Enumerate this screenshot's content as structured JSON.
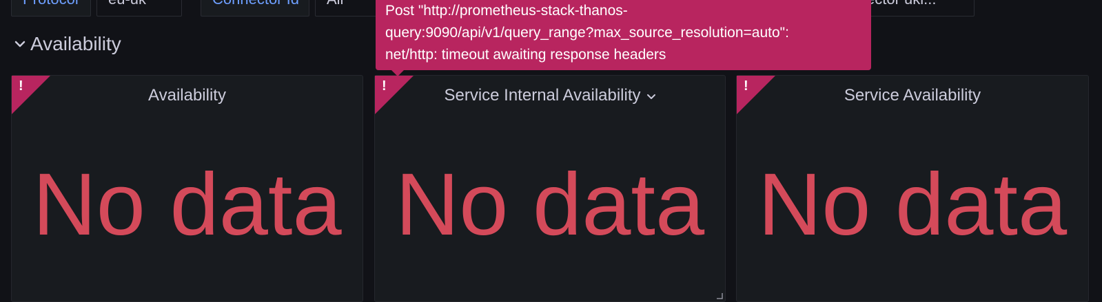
{
  "variables": [
    {
      "label": "Protocol",
      "value": "eu-uk"
    },
    {
      "label": "Connector Id",
      "value": "All"
    },
    {
      "label": "",
      "value": "...ector uki"
    }
  ],
  "row": {
    "title": "Availability"
  },
  "panels": [
    {
      "title": "Availability",
      "status": "No data",
      "error_mark": "!"
    },
    {
      "title": "Service Internal Availability",
      "status": "No data",
      "error_mark": "!"
    },
    {
      "title": "Service Availability",
      "status": "No data",
      "error_mark": "!"
    }
  ],
  "tooltip": {
    "lines": [
      "Post \"http://prometheus-stack-thanos-",
      "query:9090/api/v1/query_range?max_source_resolution=auto\":",
      "net/http: timeout awaiting response headers"
    ]
  },
  "colors": {
    "error": "#b8255f",
    "nodata": "#d44a5a",
    "label": "#6e9fff"
  },
  "icons": {
    "row_toggle": "chevron-down-icon",
    "panel_menu": "chevron-down-icon",
    "error": "exclamation-icon"
  }
}
